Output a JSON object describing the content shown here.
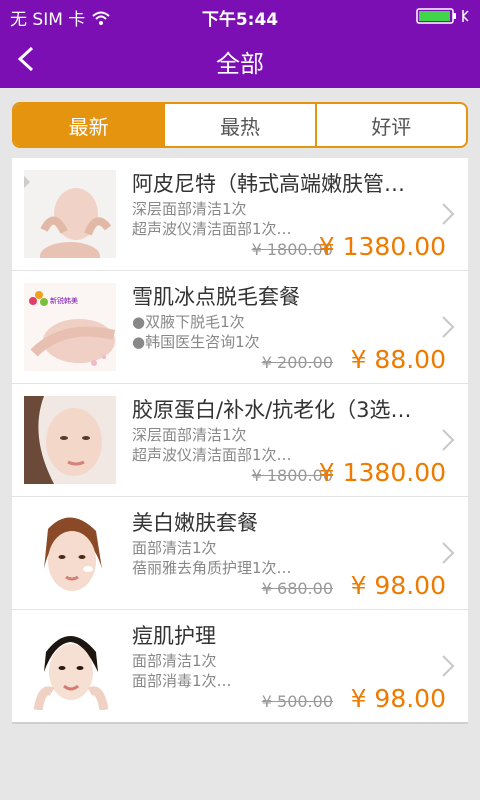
{
  "status": {
    "carrier": "无 SIM 卡",
    "time": "下午5:44"
  },
  "nav": {
    "title": "全部"
  },
  "tabs": [
    {
      "label": "最新",
      "active": true
    },
    {
      "label": "最热",
      "active": false
    },
    {
      "label": "好评",
      "active": false
    }
  ],
  "items": [
    {
      "name": "阿皮尼特（韩式高端嫩肤管…",
      "line1": "深层面部清洁1次",
      "line2": "超声波仪清洁面部1次…",
      "old_price": "¥ 1800.00",
      "price": "¥ 1380.00"
    },
    {
      "name": "雪肌冰点脱毛套餐",
      "line1": "●双腋下脱毛1次",
      "line2": "●韩国医生咨询1次",
      "old_price": "¥ 200.00",
      "price": "¥ 88.00",
      "logo_text": "新锐韩美"
    },
    {
      "name": "胶原蛋白/补水/抗老化（3选…",
      "line1": "深层面部清洁1次",
      "line2": "超声波仪清洁面部1次…",
      "old_price": "¥ 1800.00",
      "price": "¥ 1380.00"
    },
    {
      "name": "美白嫩肤套餐",
      "line1": "面部清洁1次",
      "line2": "蓓丽雅去角质护理1次…",
      "old_price": "¥ 680.00",
      "price": "¥ 98.00"
    },
    {
      "name": "痘肌护理",
      "line1": "面部清洁1次",
      "line2": "面部消毒1次…",
      "old_price": "¥ 500.00",
      "price": "¥ 98.00"
    }
  ],
  "colors": {
    "header": "#7b0fb3",
    "accent": "#e59410",
    "price": "#ef7a00"
  }
}
